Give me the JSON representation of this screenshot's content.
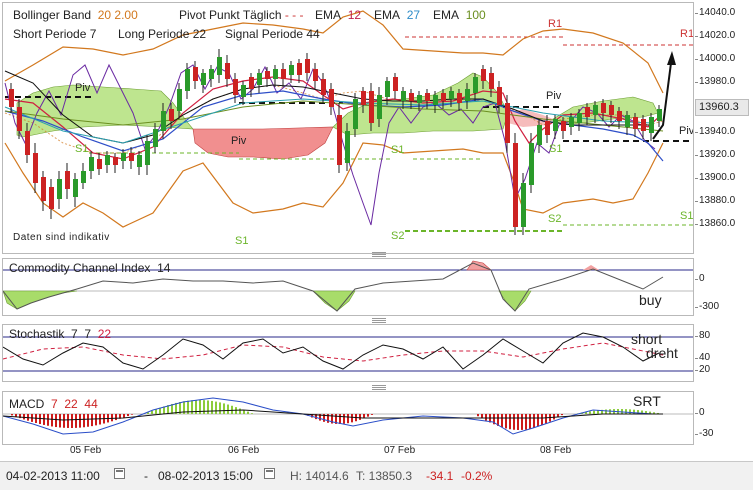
{
  "legend_main": {
    "bollinger_label": "Bollinger Band",
    "bollinger_params": "20  2.00",
    "pivot_label": "Pivot Punkt  Täglich",
    "ema_label_1": "EMA",
    "ema_1": "12",
    "ema_label_2": "EMA",
    "ema_2": "27",
    "ema_label_3": "EMA",
    "ema_3": "100",
    "short_label": "Short Periode  7",
    "long_label": "Long Periode  22",
    "signal_label": "Signal Periode  44",
    "note": "Daten sind indikativ"
  },
  "levels": {
    "r1_a": "R1",
    "r1_b": "R1",
    "piv_a": "Piv",
    "piv_b": "Piv",
    "piv_c": "Piv",
    "piv_d": "Piv",
    "s1_a": "S1",
    "s1_b": "S1",
    "s1_c": "S1",
    "s1_d": "S1",
    "s1_e": "S1",
    "s1_f": "S1",
    "s2_a": "S2",
    "s2_b": "S2"
  },
  "main_axis": [
    "14040.0",
    "14020.0",
    "14000.0",
    "13980.0",
    "13960.3",
    "13940.0",
    "13920.0",
    "13900.0",
    "13880.0",
    "13860.0"
  ],
  "current_price": "13960.3",
  "cci": {
    "title": "Commodity Channel Index",
    "period": "14",
    "axis": [
      "0",
      "-300"
    ],
    "annotation": "buy"
  },
  "stoch": {
    "title": "Stochastik",
    "k": "7",
    "d": "7",
    "slow": "22",
    "axis": [
      "80",
      "40",
      "20"
    ],
    "annotation_1": "short",
    "annotation_2": "dreht"
  },
  "macd": {
    "title": "MACD",
    "fast": "7",
    "slow": "22",
    "signal": "44",
    "axis": [
      "0",
      "-30"
    ],
    "annotation": "SRT"
  },
  "dates": [
    "05 Feb",
    "06 Feb",
    "07 Feb",
    "08 Feb"
  ],
  "status": {
    "start": "04-02-2013 11:00",
    "sep": "-",
    "end": "08-02-2013 15:00",
    "high": "H: 14014.6",
    "low": "T: 13850.3",
    "change": "-34.1",
    "change_pct": "-0.2%"
  },
  "colors": {
    "up": "#2a9a2a",
    "down": "#cc2222",
    "bollinger": "#d2781e",
    "ema12": "#d02040",
    "ema27": "#2e8cc8",
    "ema100": "#6b8f20",
    "kumo_up": "#a8dc6a",
    "kumo_down": "#ee7b7b",
    "macd_up": "#8ccc3a",
    "macd_down": "#cc1a1a"
  }
}
